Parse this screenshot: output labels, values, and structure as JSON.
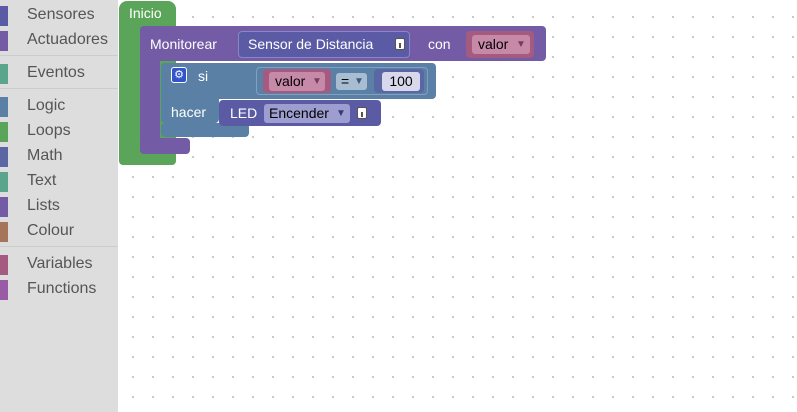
{
  "toolbox": {
    "groups": [
      [
        {
          "label": "Sensores",
          "color": "#5b5ba5"
        },
        {
          "label": "Actuadores",
          "color": "#745ba5"
        }
      ],
      [
        {
          "label": "Eventos",
          "color": "#5ba58c"
        }
      ],
      [
        {
          "label": "Logic",
          "color": "#5b80a5"
        },
        {
          "label": "Loops",
          "color": "#5ba55b"
        },
        {
          "label": "Math",
          "color": "#5b67a5"
        },
        {
          "label": "Text",
          "color": "#5ba58c"
        },
        {
          "label": "Lists",
          "color": "#745ba5"
        },
        {
          "label": "Colour",
          "color": "#a5745b"
        }
      ],
      [
        {
          "label": "Variables",
          "color": "#a55b80"
        },
        {
          "label": "Functions",
          "color": "#995ba5"
        }
      ]
    ]
  },
  "blocks": {
    "inicio": {
      "label": "Inicio",
      "color": "#5ba55b"
    },
    "monitorear": {
      "label": "Monitorear",
      "sensor_value": "Sensor de Distancia",
      "con_label": "con",
      "variable": "valor",
      "color": "#745ba5"
    },
    "if_block": {
      "si_label": "si",
      "hacer_label": "hacer",
      "variable": "valor",
      "operator": "=",
      "number": "100",
      "color": "#5b80a5"
    },
    "led": {
      "label": "LED",
      "action": "Encender",
      "color": "#5b5ba5"
    }
  }
}
